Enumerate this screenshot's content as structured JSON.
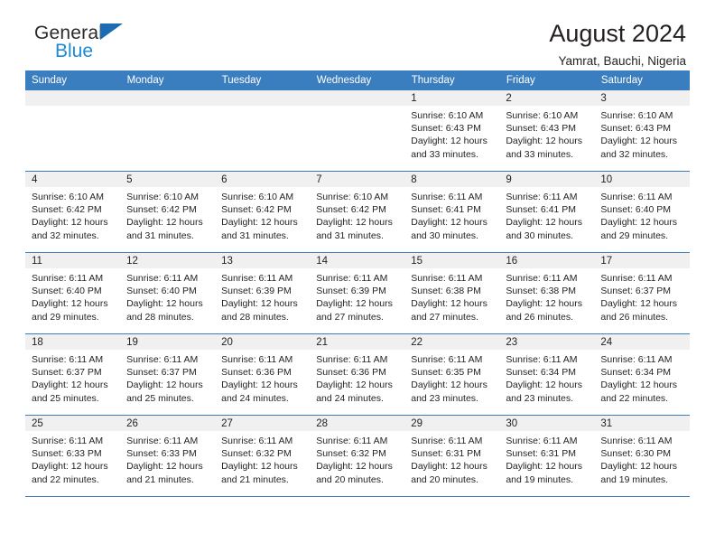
{
  "brand": {
    "name_top": "General",
    "name_bottom": "Blue"
  },
  "header": {
    "title": "August 2024",
    "subtitle": "Yamrat, Bauchi, Nigeria"
  },
  "theme": {
    "accent": "#3b7ec0",
    "logo_blue": "#1e8ad6",
    "daynum_bg": "#f0f0f0",
    "text": "#231f20"
  },
  "weekdays": [
    "Sunday",
    "Monday",
    "Tuesday",
    "Wednesday",
    "Thursday",
    "Friday",
    "Saturday"
  ],
  "labels": {
    "sunrise": "Sunrise:",
    "sunset": "Sunset:",
    "daylight": "Daylight:"
  },
  "weeks": [
    [
      {
        "day": "",
        "blank": true
      },
      {
        "day": "",
        "blank": true
      },
      {
        "day": "",
        "blank": true
      },
      {
        "day": "",
        "blank": true
      },
      {
        "day": "1",
        "sunrise": "Sunrise: 6:10 AM",
        "sunset": "Sunset: 6:43 PM",
        "daylight1": "Daylight: 12 hours",
        "daylight2": "and 33 minutes."
      },
      {
        "day": "2",
        "sunrise": "Sunrise: 6:10 AM",
        "sunset": "Sunset: 6:43 PM",
        "daylight1": "Daylight: 12 hours",
        "daylight2": "and 33 minutes."
      },
      {
        "day": "3",
        "sunrise": "Sunrise: 6:10 AM",
        "sunset": "Sunset: 6:43 PM",
        "daylight1": "Daylight: 12 hours",
        "daylight2": "and 32 minutes."
      }
    ],
    [
      {
        "day": "4",
        "sunrise": "Sunrise: 6:10 AM",
        "sunset": "Sunset: 6:42 PM",
        "daylight1": "Daylight: 12 hours",
        "daylight2": "and 32 minutes."
      },
      {
        "day": "5",
        "sunrise": "Sunrise: 6:10 AM",
        "sunset": "Sunset: 6:42 PM",
        "daylight1": "Daylight: 12 hours",
        "daylight2": "and 31 minutes."
      },
      {
        "day": "6",
        "sunrise": "Sunrise: 6:10 AM",
        "sunset": "Sunset: 6:42 PM",
        "daylight1": "Daylight: 12 hours",
        "daylight2": "and 31 minutes."
      },
      {
        "day": "7",
        "sunrise": "Sunrise: 6:10 AM",
        "sunset": "Sunset: 6:42 PM",
        "daylight1": "Daylight: 12 hours",
        "daylight2": "and 31 minutes."
      },
      {
        "day": "8",
        "sunrise": "Sunrise: 6:11 AM",
        "sunset": "Sunset: 6:41 PM",
        "daylight1": "Daylight: 12 hours",
        "daylight2": "and 30 minutes."
      },
      {
        "day": "9",
        "sunrise": "Sunrise: 6:11 AM",
        "sunset": "Sunset: 6:41 PM",
        "daylight1": "Daylight: 12 hours",
        "daylight2": "and 30 minutes."
      },
      {
        "day": "10",
        "sunrise": "Sunrise: 6:11 AM",
        "sunset": "Sunset: 6:40 PM",
        "daylight1": "Daylight: 12 hours",
        "daylight2": "and 29 minutes."
      }
    ],
    [
      {
        "day": "11",
        "sunrise": "Sunrise: 6:11 AM",
        "sunset": "Sunset: 6:40 PM",
        "daylight1": "Daylight: 12 hours",
        "daylight2": "and 29 minutes."
      },
      {
        "day": "12",
        "sunrise": "Sunrise: 6:11 AM",
        "sunset": "Sunset: 6:40 PM",
        "daylight1": "Daylight: 12 hours",
        "daylight2": "and 28 minutes."
      },
      {
        "day": "13",
        "sunrise": "Sunrise: 6:11 AM",
        "sunset": "Sunset: 6:39 PM",
        "daylight1": "Daylight: 12 hours",
        "daylight2": "and 28 minutes."
      },
      {
        "day": "14",
        "sunrise": "Sunrise: 6:11 AM",
        "sunset": "Sunset: 6:39 PM",
        "daylight1": "Daylight: 12 hours",
        "daylight2": "and 27 minutes."
      },
      {
        "day": "15",
        "sunrise": "Sunrise: 6:11 AM",
        "sunset": "Sunset: 6:38 PM",
        "daylight1": "Daylight: 12 hours",
        "daylight2": "and 27 minutes."
      },
      {
        "day": "16",
        "sunrise": "Sunrise: 6:11 AM",
        "sunset": "Sunset: 6:38 PM",
        "daylight1": "Daylight: 12 hours",
        "daylight2": "and 26 minutes."
      },
      {
        "day": "17",
        "sunrise": "Sunrise: 6:11 AM",
        "sunset": "Sunset: 6:37 PM",
        "daylight1": "Daylight: 12 hours",
        "daylight2": "and 26 minutes."
      }
    ],
    [
      {
        "day": "18",
        "sunrise": "Sunrise: 6:11 AM",
        "sunset": "Sunset: 6:37 PM",
        "daylight1": "Daylight: 12 hours",
        "daylight2": "and 25 minutes."
      },
      {
        "day": "19",
        "sunrise": "Sunrise: 6:11 AM",
        "sunset": "Sunset: 6:37 PM",
        "daylight1": "Daylight: 12 hours",
        "daylight2": "and 25 minutes."
      },
      {
        "day": "20",
        "sunrise": "Sunrise: 6:11 AM",
        "sunset": "Sunset: 6:36 PM",
        "daylight1": "Daylight: 12 hours",
        "daylight2": "and 24 minutes."
      },
      {
        "day": "21",
        "sunrise": "Sunrise: 6:11 AM",
        "sunset": "Sunset: 6:36 PM",
        "daylight1": "Daylight: 12 hours",
        "daylight2": "and 24 minutes."
      },
      {
        "day": "22",
        "sunrise": "Sunrise: 6:11 AM",
        "sunset": "Sunset: 6:35 PM",
        "daylight1": "Daylight: 12 hours",
        "daylight2": "and 23 minutes."
      },
      {
        "day": "23",
        "sunrise": "Sunrise: 6:11 AM",
        "sunset": "Sunset: 6:34 PM",
        "daylight1": "Daylight: 12 hours",
        "daylight2": "and 23 minutes."
      },
      {
        "day": "24",
        "sunrise": "Sunrise: 6:11 AM",
        "sunset": "Sunset: 6:34 PM",
        "daylight1": "Daylight: 12 hours",
        "daylight2": "and 22 minutes."
      }
    ],
    [
      {
        "day": "25",
        "sunrise": "Sunrise: 6:11 AM",
        "sunset": "Sunset: 6:33 PM",
        "daylight1": "Daylight: 12 hours",
        "daylight2": "and 22 minutes."
      },
      {
        "day": "26",
        "sunrise": "Sunrise: 6:11 AM",
        "sunset": "Sunset: 6:33 PM",
        "daylight1": "Daylight: 12 hours",
        "daylight2": "and 21 minutes."
      },
      {
        "day": "27",
        "sunrise": "Sunrise: 6:11 AM",
        "sunset": "Sunset: 6:32 PM",
        "daylight1": "Daylight: 12 hours",
        "daylight2": "and 21 minutes."
      },
      {
        "day": "28",
        "sunrise": "Sunrise: 6:11 AM",
        "sunset": "Sunset: 6:32 PM",
        "daylight1": "Daylight: 12 hours",
        "daylight2": "and 20 minutes."
      },
      {
        "day": "29",
        "sunrise": "Sunrise: 6:11 AM",
        "sunset": "Sunset: 6:31 PM",
        "daylight1": "Daylight: 12 hours",
        "daylight2": "and 20 minutes."
      },
      {
        "day": "30",
        "sunrise": "Sunrise: 6:11 AM",
        "sunset": "Sunset: 6:31 PM",
        "daylight1": "Daylight: 12 hours",
        "daylight2": "and 19 minutes."
      },
      {
        "day": "31",
        "sunrise": "Sunrise: 6:11 AM",
        "sunset": "Sunset: 6:30 PM",
        "daylight1": "Daylight: 12 hours",
        "daylight2": "and 19 minutes."
      }
    ]
  ]
}
